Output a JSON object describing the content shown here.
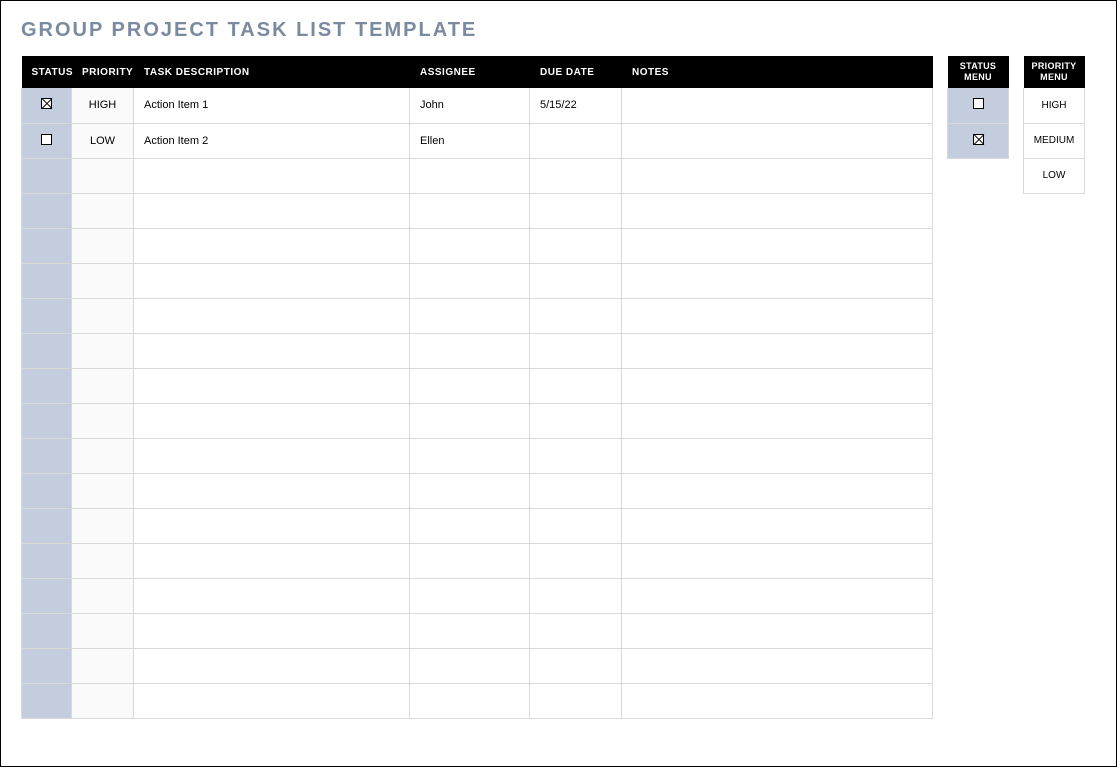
{
  "title": "GROUP PROJECT TASK LIST TEMPLATE",
  "headers": {
    "status": "STATUS",
    "priority": "PRIORITY",
    "description": "TASK DESCRIPTION",
    "assignee": "ASSIGNEE",
    "due_date": "DUE DATE",
    "notes": "NOTES"
  },
  "rows": [
    {
      "status_checked": true,
      "priority": "HIGH",
      "description": "Action Item 1",
      "assignee": "John",
      "due_date": "5/15/22",
      "notes": ""
    },
    {
      "status_checked": false,
      "priority": "LOW",
      "description": "Action Item 2",
      "assignee": "Ellen",
      "due_date": "",
      "notes": ""
    },
    {
      "status_checked": null,
      "priority": "",
      "description": "",
      "assignee": "",
      "due_date": "",
      "notes": ""
    },
    {
      "status_checked": null,
      "priority": "",
      "description": "",
      "assignee": "",
      "due_date": "",
      "notes": ""
    },
    {
      "status_checked": null,
      "priority": "",
      "description": "",
      "assignee": "",
      "due_date": "",
      "notes": ""
    },
    {
      "status_checked": null,
      "priority": "",
      "description": "",
      "assignee": "",
      "due_date": "",
      "notes": ""
    },
    {
      "status_checked": null,
      "priority": "",
      "description": "",
      "assignee": "",
      "due_date": "",
      "notes": ""
    },
    {
      "status_checked": null,
      "priority": "",
      "description": "",
      "assignee": "",
      "due_date": "",
      "notes": ""
    },
    {
      "status_checked": null,
      "priority": "",
      "description": "",
      "assignee": "",
      "due_date": "",
      "notes": ""
    },
    {
      "status_checked": null,
      "priority": "",
      "description": "",
      "assignee": "",
      "due_date": "",
      "notes": ""
    },
    {
      "status_checked": null,
      "priority": "",
      "description": "",
      "assignee": "",
      "due_date": "",
      "notes": ""
    },
    {
      "status_checked": null,
      "priority": "",
      "description": "",
      "assignee": "",
      "due_date": "",
      "notes": ""
    },
    {
      "status_checked": null,
      "priority": "",
      "description": "",
      "assignee": "",
      "due_date": "",
      "notes": ""
    },
    {
      "status_checked": null,
      "priority": "",
      "description": "",
      "assignee": "",
      "due_date": "",
      "notes": ""
    },
    {
      "status_checked": null,
      "priority": "",
      "description": "",
      "assignee": "",
      "due_date": "",
      "notes": ""
    },
    {
      "status_checked": null,
      "priority": "",
      "description": "",
      "assignee": "",
      "due_date": "",
      "notes": ""
    },
    {
      "status_checked": null,
      "priority": "",
      "description": "",
      "assignee": "",
      "due_date": "",
      "notes": ""
    },
    {
      "status_checked": null,
      "priority": "",
      "description": "",
      "assignee": "",
      "due_date": "",
      "notes": ""
    }
  ],
  "status_menu": {
    "header": "STATUS MENU",
    "items": [
      {
        "checked": false
      },
      {
        "checked": true
      }
    ]
  },
  "priority_menu": {
    "header": "PRIORITY MENU",
    "items": [
      "HIGH",
      "MEDIUM",
      "LOW"
    ]
  }
}
